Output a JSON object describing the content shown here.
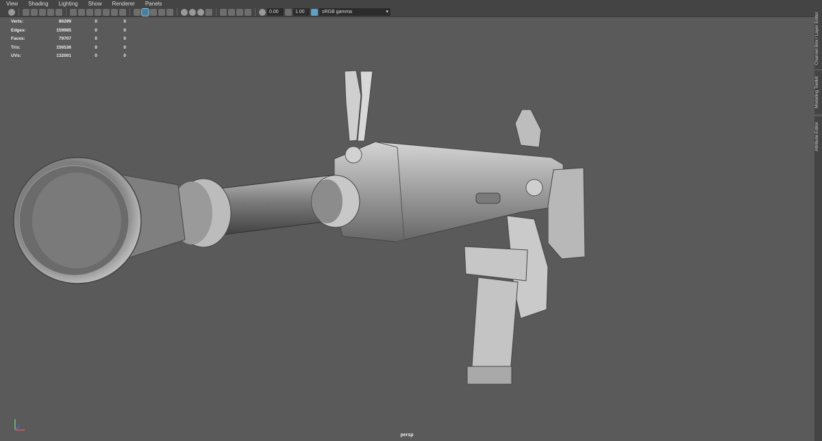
{
  "menu": {
    "items": [
      "View",
      "Shading",
      "Lighting",
      "Show",
      "Renderer",
      "Panels"
    ]
  },
  "toolbar": {
    "exposure": "0.00",
    "gamma": "1.00",
    "colorspace": "sRGB gamma"
  },
  "hud": {
    "rows": [
      {
        "label": "Verts:",
        "v1": "80299",
        "v2": "0",
        "v3": "0"
      },
      {
        "label": "Edges:",
        "v1": "159985",
        "v2": "0",
        "v3": "0"
      },
      {
        "label": "Faces:",
        "v1": "79707",
        "v2": "0",
        "v3": "0"
      },
      {
        "label": "Tris:",
        "v1": "156536",
        "v2": "0",
        "v3": "0"
      },
      {
        "label": "UVs:",
        "v1": "132001",
        "v2": "0",
        "v3": "0"
      }
    ]
  },
  "side_tabs": [
    "Channel Box / Layer Editor",
    "Modeling Toolkit",
    "Attribute Editor"
  ],
  "camera": "persp",
  "colors": {
    "viewport_bg": "#5a5a5a",
    "ui_bg": "#444444",
    "accent": "#5aa3c8"
  }
}
